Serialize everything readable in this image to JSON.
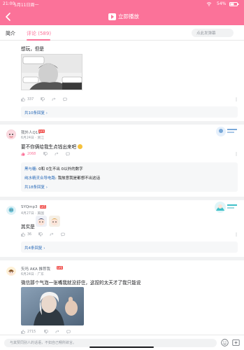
{
  "status": {
    "time": "21:00",
    "date": "5月11日周一",
    "battery": "54%"
  },
  "header": {
    "play_label": "立即播放",
    "accent": "#fb7299"
  },
  "tabs": {
    "intro": "简介",
    "comments": "评论",
    "comment_count": "(589)",
    "search_placeholder": "点此发弹幕"
  },
  "comments": [
    {
      "id": "c0",
      "text": "想玩，但是",
      "likes": "337",
      "reply_link": "共10条回复 ›",
      "image_caption": [
        "大家在打开看看吗想那",
        "还觉得"
      ]
    },
    {
      "id": "c1",
      "name": "我外人Q11",
      "badge": "LV4",
      "meta": "6月24日 · 浙江",
      "text": "要不你俩给我生点钱出来吧",
      "likes": "2068",
      "replies": [
        {
          "name": "黑与糖",
          "text": ": 0和 0生不出 0以外的数字"
        },
        {
          "name": "纯水精灵合导电路",
          "text": ": 我故意我是都想不出这话"
        }
      ],
      "reply_link": "共18条回复 ›"
    },
    {
      "id": "c2",
      "name": "SYQmp3",
      "badge": "LV5",
      "meta": "4月27日 · 美国",
      "text": "其实是",
      "likes": "36",
      "reply_link": "共4条回复 ›"
    },
    {
      "id": "c3",
      "name": "矢吗 AKA 推荐我",
      "badge": "LV6",
      "meta": "6月24日 · 广东",
      "text": "微信那个气泡一张嘴我就没舒住，这捏的太天才了我只能说",
      "likes": "2715"
    }
  ],
  "bottom": {
    "placeholder": "与其赞同别人的话语，不如自己畅所欲言。"
  }
}
